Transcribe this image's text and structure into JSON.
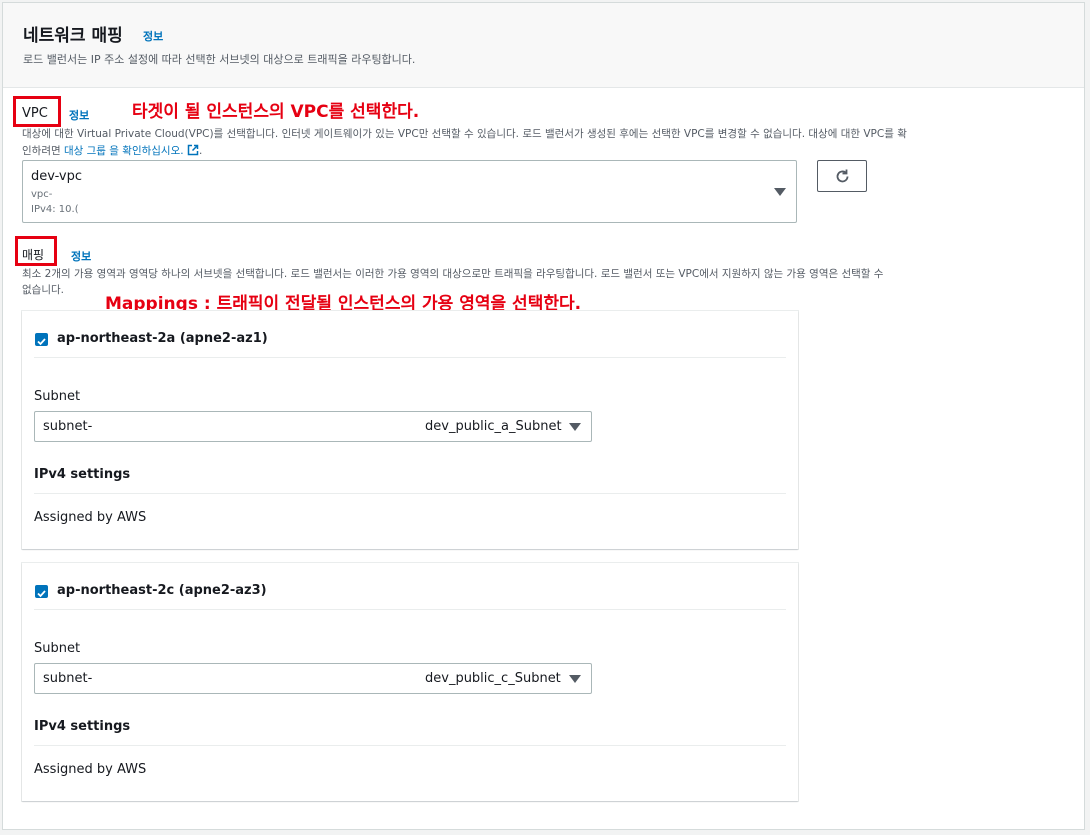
{
  "header": {
    "title": "네트워크 매핑",
    "info": "정보",
    "description": "로드 밸런서는 IP 주소 설정에 따라 선택한 서브넷의 대상으로 트래픽을 라우팅합니다."
  },
  "vpc": {
    "label": "VPC",
    "info": "정보",
    "annotation": "타겟이 될 인스턴스의 VPC를 선택한다.",
    "description_line1": "대상에 대한 Virtual Private Cloud(VPC)를 선택합니다. 인터넷 게이트웨이가 있는 VPC만 선택할 수 있습니다. 로드 밸런서가 생성된 후에는 선택한 VPC를 변경할 수 없습니다. 대상에 대한 VPC를 확",
    "description_line2_prefix": "인하려면 ",
    "description_link": "대상 그룹 을 확인하십시오.",
    "description_suffix": ".",
    "selected_name": "dev-vpc",
    "selected_id": "vpc-",
    "selected_cidr": "IPv4: 10.(",
    "refresh_icon": "refresh-icon"
  },
  "mapping": {
    "label": "매핑",
    "info": "정보",
    "description_line1": "최소 2개의 가용 영역과 영역당 하나의 서브넷을 선택합니다. 로드 밸런서는 이러한 가용 영역의 대상으로만 트래픽을 라우팅합니다. 로드 밸런서 또는 VPC에서 지원하지 않는 가용 영역은 선택할 수",
    "description_line2": "없습니다.",
    "annotation": "Mappings : 트래픽이 전달될 인스턴스의 가용 영역을 선택한다.",
    "zones": [
      {
        "name": "ap-northeast-2a (apne2-az1)",
        "checked": true,
        "subnet_label": "Subnet",
        "subnet_id": "subnet-",
        "subnet_name": "dev_public_a_Subnet",
        "ipv4_label": "IPv4 settings",
        "ipv4_value": "Assigned by AWS"
      },
      {
        "name": "ap-northeast-2c (apne2-az3)",
        "checked": true,
        "subnet_label": "Subnet",
        "subnet_id": "subnet-",
        "subnet_name": "dev_public_c_Subnet",
        "ipv4_label": "IPv4 settings",
        "ipv4_value": "Assigned by AWS"
      }
    ]
  },
  "colors": {
    "annotation": "#e60012",
    "link": "#0073bb",
    "checkbox": "#0073bb"
  }
}
